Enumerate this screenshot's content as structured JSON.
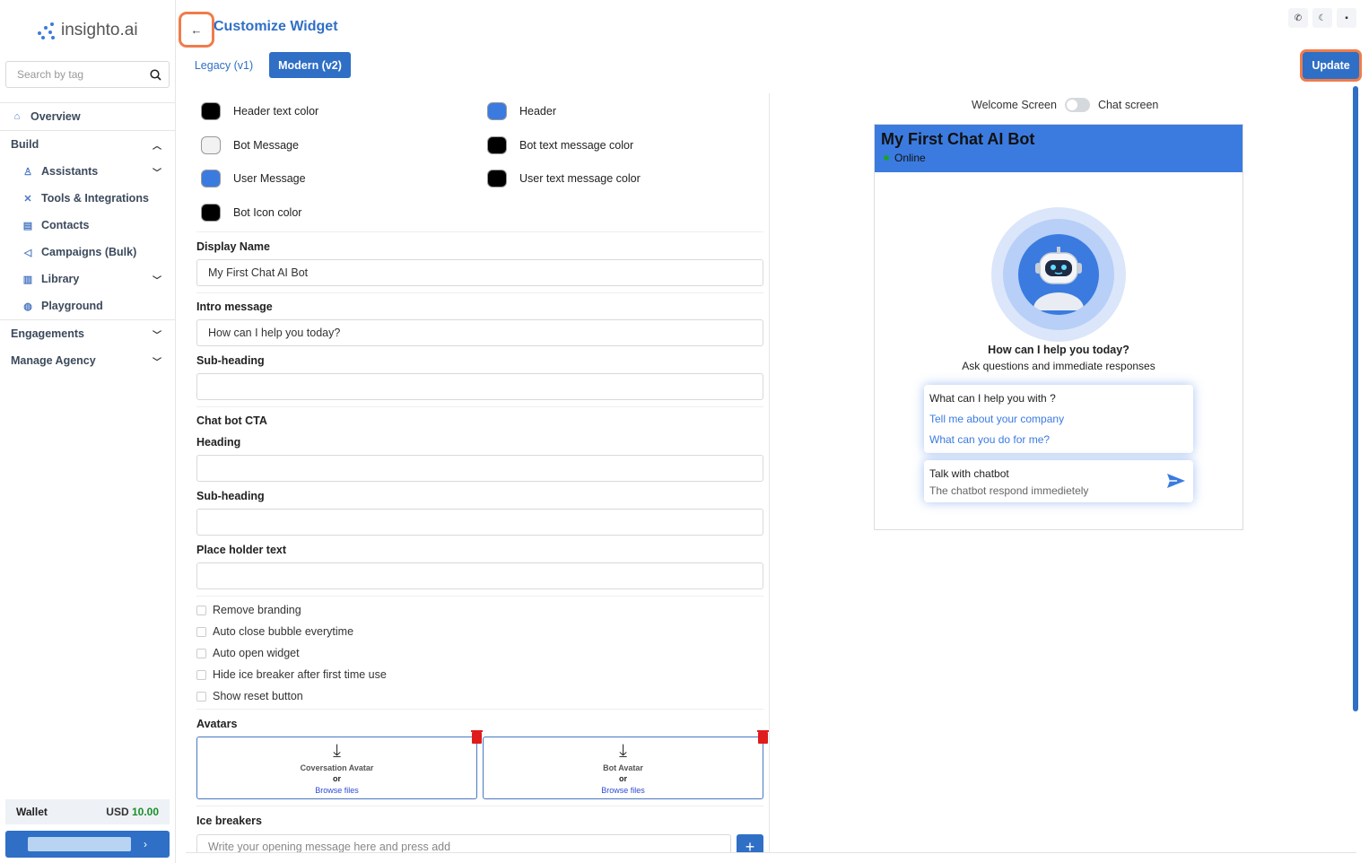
{
  "brand": {
    "name": "insighto.ai"
  },
  "search": {
    "placeholder": "Search by tag"
  },
  "nav": {
    "overview": "Overview",
    "build": "Build",
    "items": [
      {
        "label": "Assistants",
        "icon": "user-icon",
        "chevron": true
      },
      {
        "label": "Tools & Integrations",
        "icon": "tools-icon",
        "chevron": false
      },
      {
        "label": "Contacts",
        "icon": "contacts-icon",
        "chevron": false
      },
      {
        "label": "Campaigns (Bulk)",
        "icon": "megaphone-icon",
        "chevron": false
      },
      {
        "label": "Library",
        "icon": "library-icon",
        "chevron": true
      },
      {
        "label": "Playground",
        "icon": "gamepad-icon",
        "chevron": false
      }
    ],
    "engagements": "Engagements",
    "manage_agency": "Manage Agency"
  },
  "wallet": {
    "label": "Wallet",
    "currency": "USD",
    "amount": "10.00"
  },
  "header": {
    "title": "Customize Widget",
    "tabs": {
      "legacy": "Legacy (v1)",
      "modern": "Modern (v2)"
    },
    "update": "Update"
  },
  "colors": {
    "header_text": {
      "label": "Header text color",
      "value": "#000000"
    },
    "header": {
      "label": "Header",
      "value": "#3b7be0"
    },
    "bot_message": {
      "label": "Bot Message",
      "value": "#f2f2f2"
    },
    "bot_text": {
      "label": "Bot text message color",
      "value": "#000000"
    },
    "user_message": {
      "label": "User Message",
      "value": "#3b7be0"
    },
    "user_text": {
      "label": "User text message color",
      "value": "#000000"
    },
    "bot_icon": {
      "label": "Bot Icon color",
      "value": "#000000"
    }
  },
  "form": {
    "display_name_label": "Display Name",
    "display_name_value": "My First Chat AI Bot",
    "intro_label": "Intro message",
    "intro_value": "How can I help you today?",
    "subheading_label": "Sub-heading",
    "subheading_value": "",
    "cta_title": "Chat bot CTA",
    "cta_heading_label": "Heading",
    "cta_heading_value": "",
    "cta_subheading_label": "Sub-heading",
    "cta_subheading_value": "",
    "placeholder_label": "Place holder text",
    "placeholder_value": "",
    "checks": [
      "Remove branding",
      "Auto close bubble everytime",
      "Auto open widget",
      "Hide ice breaker after first time use",
      "Show reset button"
    ],
    "avatars_label": "Avatars",
    "avatar_conv": "Coversation Avatar",
    "avatar_bot": "Bot Avatar",
    "or": "or",
    "browse": "Browse files",
    "ice_label": "Ice breakers",
    "ice_placeholder": "Write your opening message here and press add"
  },
  "preview": {
    "toggle_left": "Welcome Screen",
    "toggle_right": "Chat screen",
    "title": "My First Chat AI Bot",
    "status": "Online",
    "question": "How can I help you today?",
    "subtitle": "Ask questions and immediate responses",
    "card_question": "What can I help you with ?",
    "suggestions": [
      "Tell me about your company",
      "What can you do for me?"
    ],
    "cta_title": "Talk with chatbot",
    "cta_sub": "The chatbot respond immedietely"
  }
}
